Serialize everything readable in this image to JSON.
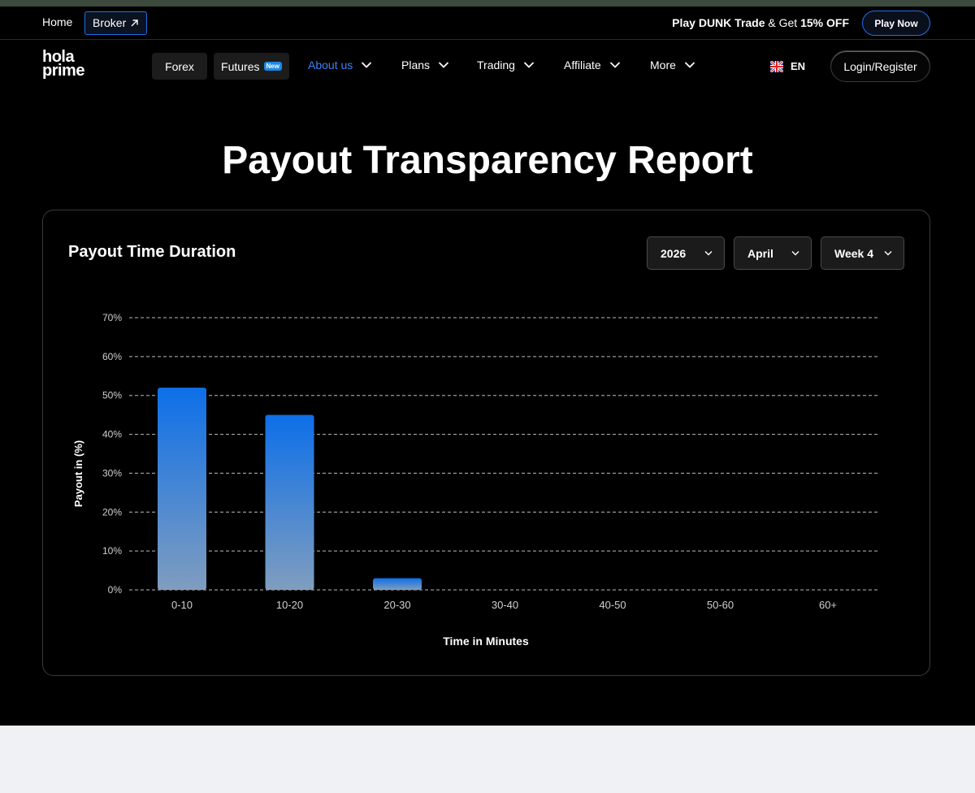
{
  "topbar": {
    "home_label": "Home",
    "broker_label": "Broker",
    "promo": {
      "part1": "Play DUNK Trade",
      "part2": " & Get ",
      "part3": "15% OFF"
    },
    "play_now_label": "Play Now"
  },
  "nav": {
    "logo_line1": "hola",
    "logo_line2": "prime",
    "forex_label": "Forex",
    "futures_label": "Futures",
    "futures_badge": "New",
    "items": [
      {
        "label": "About us"
      },
      {
        "label": "Plans"
      },
      {
        "label": "Trading"
      },
      {
        "label": "Affiliate"
      },
      {
        "label": "More"
      }
    ],
    "language": "EN",
    "login_label": "Login/Register"
  },
  "page": {
    "title": "Payout Transparency Report"
  },
  "card": {
    "title": "Payout Time Duration",
    "filters": {
      "year": "2026",
      "month": "April",
      "week": "Week 4"
    }
  },
  "colors": {
    "accent": "#1f6feb",
    "bar_top": "#0d6fe8",
    "bar_bottom": "#7f9dbf"
  },
  "chart_data": {
    "type": "bar",
    "categories": [
      "0-10",
      "10-20",
      "20-30",
      "30-40",
      "40-50",
      "50-60",
      "60+"
    ],
    "values": [
      52,
      45,
      3,
      0,
      0,
      0,
      0
    ],
    "xlabel": "Time in Minutes",
    "ylabel": "Payout in (%)",
    "ylim": [
      0,
      70
    ],
    "yticks": [
      "0%",
      "10%",
      "20%",
      "30%",
      "40%",
      "50%",
      "60%",
      "70%"
    ],
    "grid": true
  }
}
